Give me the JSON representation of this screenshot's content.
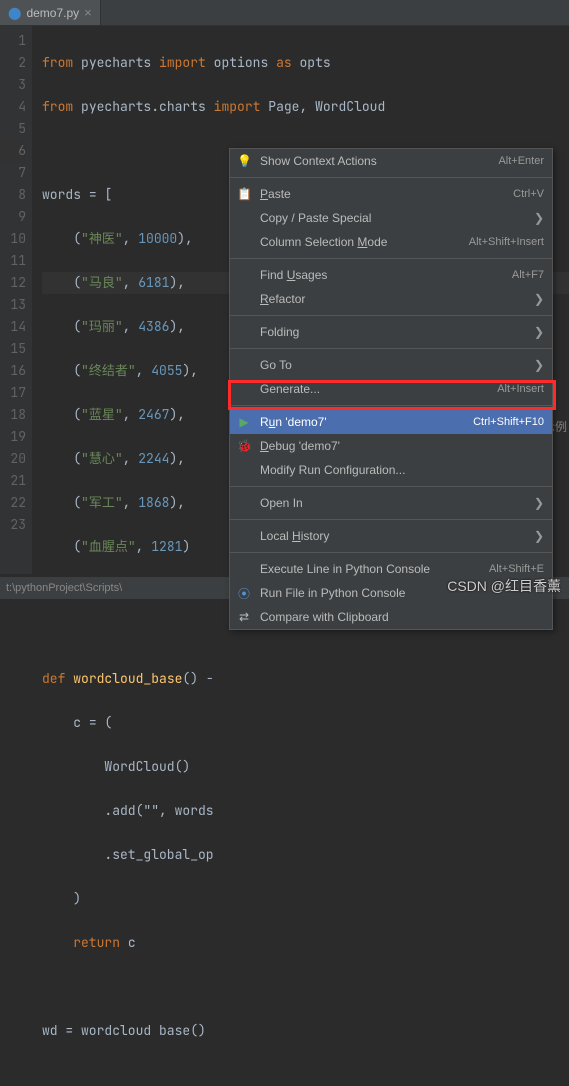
{
  "tab": {
    "filename": "demo7.py"
  },
  "code": {
    "l1": {
      "kw1": "from",
      "mod": "pyecharts",
      "kw2": "import",
      "opt": "options",
      "kw3": "as",
      "alias": "opts"
    },
    "l2": {
      "kw1": "from",
      "mod": "pyecharts.charts",
      "kw2": "import",
      "cls1": "Page",
      "cls2": "WordCloud"
    },
    "l4": {
      "var": "words",
      "eq": "=",
      "br": "["
    },
    "tuples": [
      {
        "s": "\"神医\"",
        "n": "10000"
      },
      {
        "s": "\"马良\"",
        "n": "6181"
      },
      {
        "s": "\"玛丽\"",
        "n": "4386"
      },
      {
        "s": "\"终结者\"",
        "n": "4055"
      },
      {
        "s": "\"蓝星\"",
        "n": "2467"
      },
      {
        "s": "\"慧心\"",
        "n": "2244"
      },
      {
        "s": "\"军工\"",
        "n": "1868"
      },
      {
        "s": "\"血腥点\"",
        "n": "1281"
      }
    ],
    "l15": {
      "kw": "def",
      "fn": "wordcloud_base",
      "rest": "() -"
    },
    "l16": {
      "var": "c",
      "rest": " = ("
    },
    "l17": "WordCloud()",
    "l18": ".add(\"\", words",
    "l19": ".set_global_op",
    "l20": ")",
    "l21": {
      "kw": "return",
      "var": "c"
    },
    "l23": "wd = wordcloud base()"
  },
  "menu": {
    "show_context": "Show Context Actions",
    "show_context_sc": "Alt+Enter",
    "paste": "Paste",
    "paste_sc": "Ctrl+V",
    "copy_paste": "Copy / Paste Special",
    "col_sel": "Column Selection Mode",
    "col_sel_sc": "Alt+Shift+Insert",
    "find_usages": "Find Usages",
    "find_usages_sc": "Alt+F7",
    "refactor": "Refactor",
    "folding": "Folding",
    "goto": "Go To",
    "generate": "Generate...",
    "generate_sc": "Alt+Insert",
    "run": "Run 'demo7'",
    "run_sc": "Ctrl+Shift+F10",
    "debug": "Debug 'demo7'",
    "modify": "Modify Run Configuration...",
    "open_in": "Open In",
    "local_history": "Local History",
    "exec_line": "Execute Line in Python Console",
    "exec_line_sc": "Alt+Shift+E",
    "run_console": "Run File in Python Console",
    "compare": "Compare with Clipboard"
  },
  "statusbar": "t:\\pythonProject\\Scripts\\",
  "watermark": "CSDN @红目香薰",
  "example": "示例",
  "chevron": "❯"
}
